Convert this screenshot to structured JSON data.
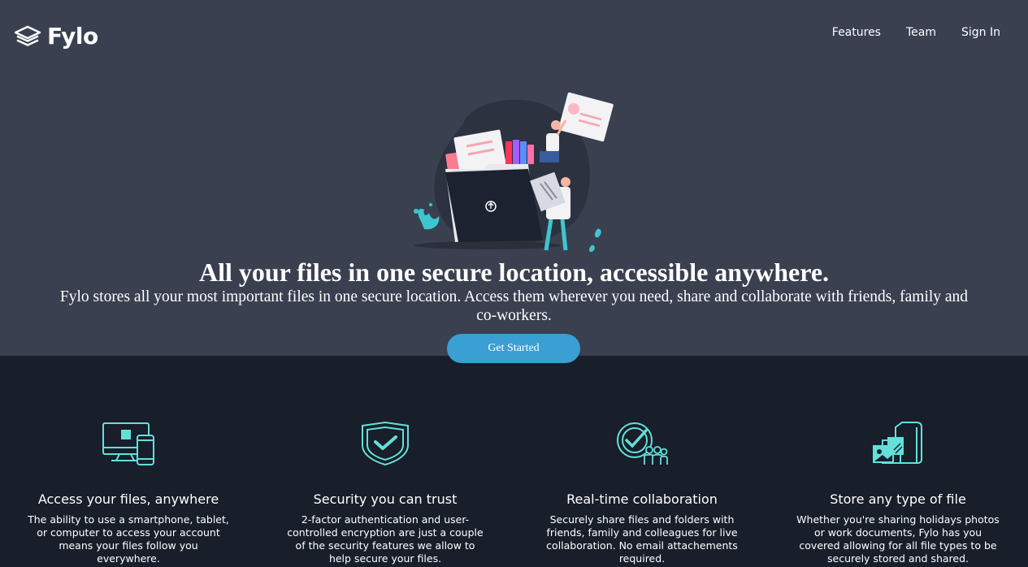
{
  "brand": {
    "name": "Fylo",
    "icon": "layers-icon"
  },
  "nav": {
    "items": [
      "Features",
      "Team",
      "Sign In"
    ]
  },
  "hero": {
    "title": "All your files in one secure location, accessible anywhere.",
    "subtitle": "Fylo stores all your most important files in one secure location. Access them wherever you need, share and collaborate with friends, family and co-workers.",
    "cta_label": "Get Started",
    "illustration": "intro-illustration"
  },
  "features": [
    {
      "icon": "devices-icon",
      "title": "Access your files, anywhere",
      "text": "The ability to use a smartphone, tablet, or computer to access your account means your files follow you everywhere."
    },
    {
      "icon": "shield-check-icon",
      "title": "Security you can trust",
      "text": "2-factor authentication and user-controlled encryption are just a couple of the security features we allow to help secure your files."
    },
    {
      "icon": "collaboration-icon",
      "title": "Real-time collaboration",
      "text": "Securely share files and folders with friends, family and colleagues for live collaboration. No email attachements required."
    },
    {
      "icon": "folder-files-icon",
      "title": "Store any type of file",
      "text": "Whether you're sharing holidays photos or work documents, Fylo has you covered allowing for all file types to be securely stored and shared."
    }
  ],
  "colors": {
    "hero_bg": "#3a4050",
    "body_bg": "#181e2a",
    "accent": "#3a9fd3",
    "icon_cyan": "#62e0d9",
    "pink": "#fa7c91"
  }
}
